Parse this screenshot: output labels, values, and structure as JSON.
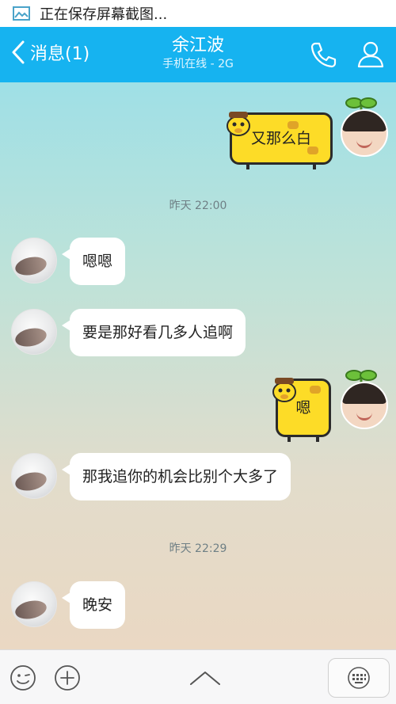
{
  "status_bar": {
    "text": "正在保存屏幕截图..."
  },
  "header": {
    "back_label": "消息(1)",
    "contact_name": "余江波",
    "contact_status": "手机在线 - 2G"
  },
  "messages": [
    {
      "side": "right",
      "text": "又那么白"
    },
    {
      "type": "timestamp",
      "text": "昨天 22:00"
    },
    {
      "side": "left",
      "text": "嗯嗯"
    },
    {
      "side": "left",
      "text": "要是那好看几多人追啊"
    },
    {
      "side": "right",
      "text": "嗯"
    },
    {
      "side": "left",
      "text": "那我追你的机会比别个大多了"
    },
    {
      "type": "timestamp",
      "text": "昨天 22:29"
    },
    {
      "side": "left",
      "text": "晚安"
    }
  ],
  "colors": {
    "header": "#16b3f0",
    "bubble_right": "#fddc27",
    "bubble_left": "#ffffff"
  },
  "toolbar": {
    "icons": [
      "emoji-icon",
      "plus-icon",
      "chevron-up-icon",
      "keyboard-icon"
    ]
  }
}
